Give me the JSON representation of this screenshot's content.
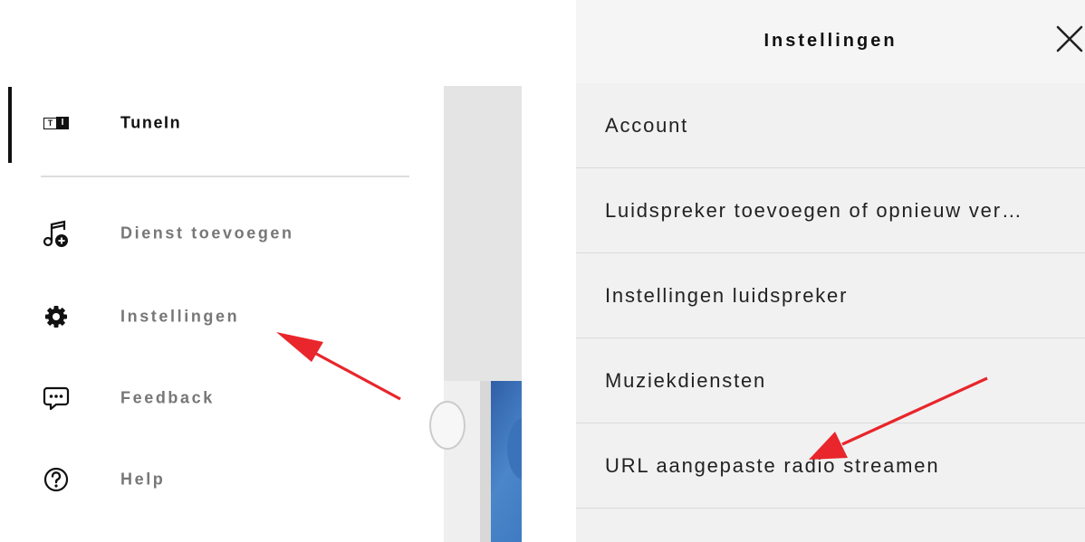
{
  "sidebar": {
    "items": [
      {
        "label": "TuneIn",
        "icon": "tunein-logo-icon",
        "active": true
      },
      {
        "label": "Dienst toevoegen",
        "icon": "music-add-icon",
        "active": false
      },
      {
        "label": "Instellingen",
        "icon": "gear-icon",
        "active": false
      },
      {
        "label": "Feedback",
        "icon": "feedback-bubble-icon",
        "active": false
      },
      {
        "label": "Help",
        "icon": "help-circle-icon",
        "active": false
      }
    ],
    "logo_t": "T",
    "logo_i": "I"
  },
  "settings": {
    "title": "Instellingen",
    "close_icon": "close-icon",
    "items": [
      {
        "label": "Account"
      },
      {
        "label": "Luidspreker toevoegen of opnieuw ver…"
      },
      {
        "label": "Instellingen luidspreker"
      },
      {
        "label": "Muziekdiensten"
      },
      {
        "label": "URL aangepaste radio streamen"
      }
    ]
  },
  "colors": {
    "accent_arrow": "#e8262b",
    "active_text": "#111111",
    "inactive_text": "#777777",
    "panel_background": "#f1f1f1"
  }
}
